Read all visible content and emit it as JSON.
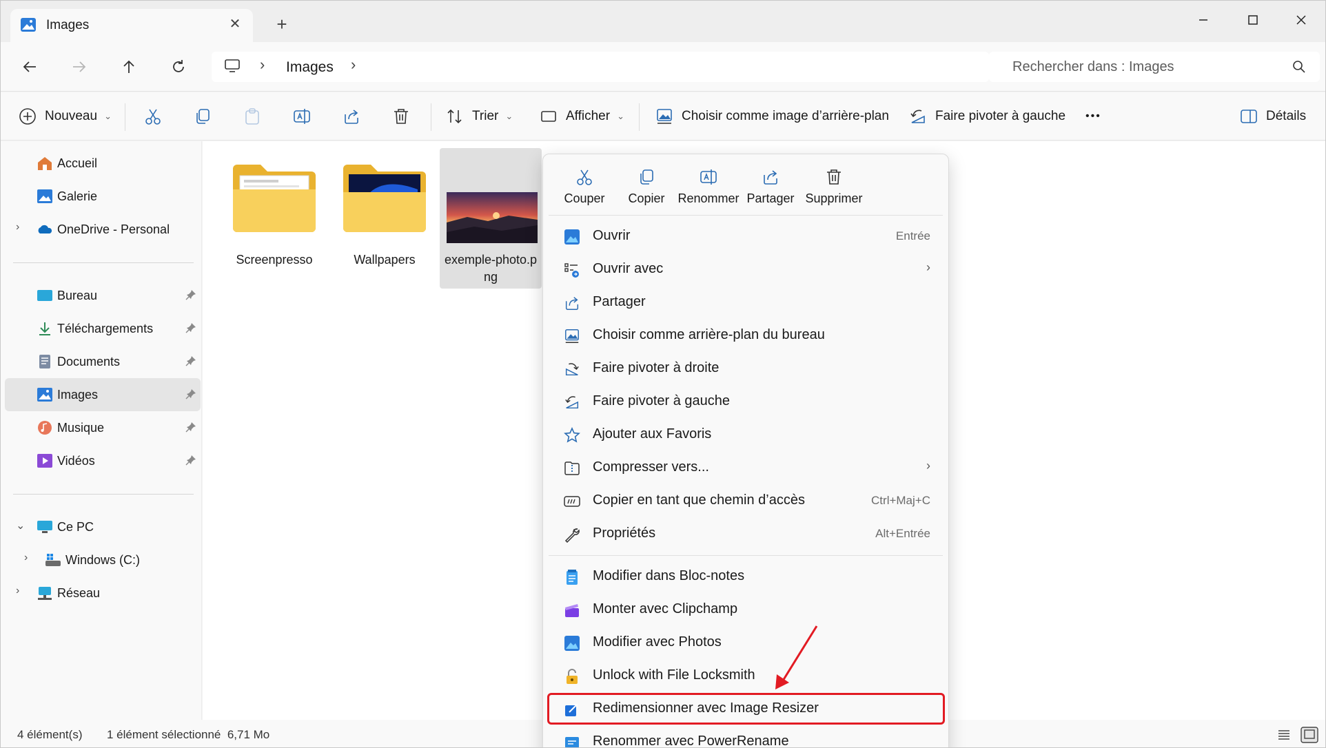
{
  "window": {
    "tab_title": "Images",
    "new_tab": "+",
    "close_tab": "✕"
  },
  "nav": {
    "breadcrumb": "Images",
    "search_placeholder": "Rechercher dans : Images"
  },
  "commandbar": {
    "new": "Nouveau",
    "sort": "Trier",
    "view": "Afficher",
    "set_background": "Choisir comme image d’arrière-plan",
    "rotate_left": "Faire pivoter à gauche",
    "more": "•••",
    "details": "Détails"
  },
  "sidebar": {
    "items": [
      {
        "label": "Accueil",
        "icon": "home-icon"
      },
      {
        "label": "Galerie",
        "icon": "gallery-icon"
      },
      {
        "label": "OneDrive - Personal",
        "icon": "onedrive-icon"
      },
      {
        "label": "Bureau",
        "icon": "desktop-icon"
      },
      {
        "label": "Téléchargements",
        "icon": "download-icon"
      },
      {
        "label": "Documents",
        "icon": "documents-icon"
      },
      {
        "label": "Images",
        "icon": "images-icon"
      },
      {
        "label": "Musique",
        "icon": "music-icon"
      },
      {
        "label": "Vidéos",
        "icon": "videos-icon"
      },
      {
        "label": "Ce PC",
        "icon": "pc-icon"
      },
      {
        "label": "Windows (C:)",
        "icon": "drive-icon"
      },
      {
        "label": "Réseau",
        "icon": "network-icon"
      }
    ]
  },
  "files": [
    {
      "name": "Screenpresso"
    },
    {
      "name": "Wallpapers"
    },
    {
      "name_line1": "exemple-photo.p",
      "name_line2": "ng"
    }
  ],
  "status": {
    "count": "4 élément(s)",
    "selection": "1 élément sélectionné  6,71 Mo"
  },
  "context_menu": {
    "quick_actions": [
      "Couper",
      "Copier",
      "Renommer",
      "Partager",
      "Supprimer"
    ],
    "items": [
      {
        "label": "Ouvrir",
        "shortcut": "Entrée"
      },
      {
        "label": "Ouvrir avec"
      },
      {
        "label": "Partager"
      },
      {
        "label": "Choisir comme arrière-plan du bureau"
      },
      {
        "label": "Faire pivoter à droite"
      },
      {
        "label": "Faire pivoter à gauche"
      },
      {
        "label": "Ajouter aux Favoris"
      },
      {
        "label": "Compresser vers..."
      },
      {
        "label": "Copier en tant que chemin d’accès",
        "shortcut": "Ctrl+Maj+C"
      },
      {
        "label": "Propriétés",
        "shortcut": "Alt+Entrée"
      },
      {
        "label": "Modifier dans Bloc-notes"
      },
      {
        "label": "Monter avec Clipchamp"
      },
      {
        "label": "Modifier avec Photos"
      },
      {
        "label": "Unlock with File Locksmith"
      },
      {
        "label": "Redimensionner avec Image Resizer"
      },
      {
        "label": "Renommer avec PowerRename"
      }
    ]
  },
  "colors": {
    "accent": "#0067c0",
    "highlight": "#e21b23",
    "folder": "#f8c94c"
  }
}
